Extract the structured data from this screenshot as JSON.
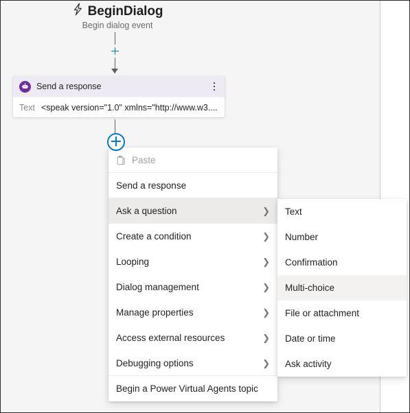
{
  "trigger": {
    "icon": "lightning-bolt-icon",
    "title": "BeginDialog",
    "subtitle": "Begin dialog event"
  },
  "connectors": {
    "add_node_top_label": "+",
    "add_node_bottom_label": "+"
  },
  "action_card": {
    "icon": "bot-message-icon",
    "title": "Send a response",
    "overflow_icon": "kebab-menu-icon",
    "field_label": "Text",
    "field_value": "<speak version=\"1.0\" xmlns=\"http://www.w3...."
  },
  "context_menu": {
    "items": [
      {
        "label": "Paste",
        "icon": "clipboard-icon",
        "disabled": true,
        "submenu": false,
        "selected": false,
        "separator_below": true
      },
      {
        "label": "Send a response",
        "icon": null,
        "disabled": false,
        "submenu": false,
        "selected": false,
        "separator_below": true
      },
      {
        "label": "Ask a question",
        "icon": null,
        "disabled": false,
        "submenu": true,
        "selected": true,
        "separator_below": false
      },
      {
        "label": "Create a condition",
        "icon": null,
        "disabled": false,
        "submenu": true,
        "selected": false,
        "separator_below": false
      },
      {
        "label": "Looping",
        "icon": null,
        "disabled": false,
        "submenu": true,
        "selected": false,
        "separator_below": false
      },
      {
        "label": "Dialog management",
        "icon": null,
        "disabled": false,
        "submenu": true,
        "selected": false,
        "separator_below": false
      },
      {
        "label": "Manage properties",
        "icon": null,
        "disabled": false,
        "submenu": true,
        "selected": false,
        "separator_below": false
      },
      {
        "label": "Access external resources",
        "icon": null,
        "disabled": false,
        "submenu": true,
        "selected": false,
        "separator_below": false
      },
      {
        "label": "Debugging options",
        "icon": null,
        "disabled": false,
        "submenu": true,
        "selected": false,
        "separator_below": true
      },
      {
        "label": "Begin a Power Virtual Agents topic",
        "icon": null,
        "disabled": false,
        "submenu": false,
        "selected": false,
        "separator_below": false
      }
    ],
    "chevron_glyph": "❯"
  },
  "submenu": {
    "parent": "Ask a question",
    "items": [
      {
        "label": "Text",
        "selected": false
      },
      {
        "label": "Number",
        "selected": false
      },
      {
        "label": "Confirmation",
        "selected": false
      },
      {
        "label": "Multi-choice",
        "selected": true
      },
      {
        "label": "File or attachment",
        "selected": false
      },
      {
        "label": "Date or time",
        "selected": false
      },
      {
        "label": "Ask activity",
        "selected": false
      }
    ]
  },
  "colors": {
    "canvas": "#f5f5f5",
    "accent_blue": "#0078d4",
    "card_header": "#edeaf3",
    "card_icon": "#6b2fa0",
    "menu_selected": "#edebe9",
    "submenu_selected": "#f3f2f1"
  }
}
